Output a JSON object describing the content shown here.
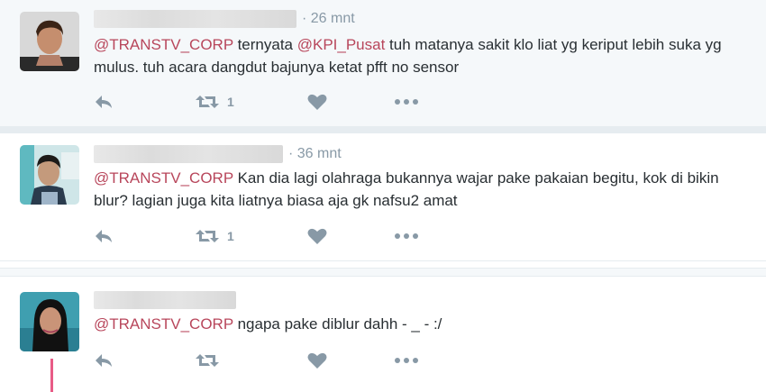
{
  "tweets": [
    {
      "time": "· 26 mnt",
      "segments": [
        {
          "text": "@TRANSTV_CORP",
          "type": "mention"
        },
        {
          "text": " ternyata ",
          "type": "text"
        },
        {
          "text": "@KPI_Pusat",
          "type": "mention"
        },
        {
          "text": " tuh matanya sakit klo liat yg keriput lebih suka yg mulus. tuh acara dangdut bajunya ketat pfft no sensor",
          "type": "text"
        }
      ],
      "retweet_count": "1"
    },
    {
      "time": "· 36 mnt",
      "segments": [
        {
          "text": "@TRANSTV_CORP",
          "type": "mention"
        },
        {
          "text": " Kan dia lagi olahraga bukannya wajar pake pakaian begitu, kok di bikin blur? lagian juga kita liatnya biasa aja gk nafsu2 amat",
          "type": "text"
        }
      ],
      "retweet_count": "1"
    },
    {
      "time": "",
      "segments": [
        {
          "text": "@TRANSTV_CORP",
          "type": "mention"
        },
        {
          "text": " ngapa pake diblur dahh - _ - :/",
          "type": "text"
        }
      ],
      "retweet_count": ""
    }
  ],
  "icons": {
    "reply": "reply-icon",
    "retweet": "retweet-icon",
    "like": "heart-icon",
    "more": "more-icon"
  },
  "colors": {
    "mention": "#b8465b",
    "icon": "#8899a6",
    "text": "#292f33",
    "thread": "#e0245e"
  }
}
